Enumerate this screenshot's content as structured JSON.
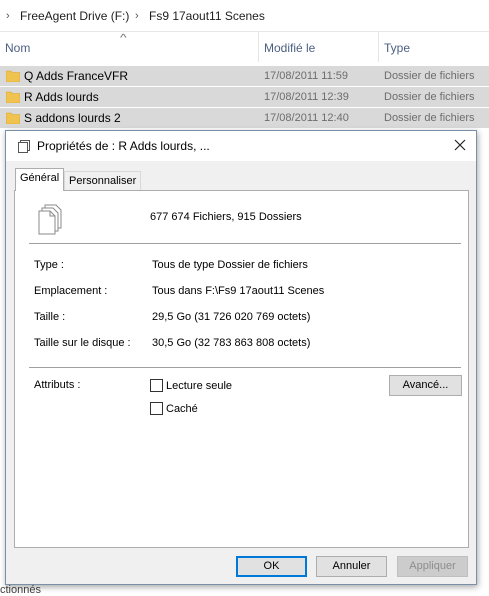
{
  "breadcrumb": {
    "items": [
      "FreeAgent Drive (F:)",
      "Fs9 17aout11 Scenes"
    ]
  },
  "columns": {
    "name": "Nom",
    "modified": "Modifié le",
    "type": "Type"
  },
  "files": [
    {
      "name": "Q Adds FranceVFR",
      "date": "17/08/2011 11:59",
      "type": "Dossier de fichiers"
    },
    {
      "name": "R Adds lourds",
      "date": "17/08/2011 12:39",
      "type": "Dossier de fichiers"
    },
    {
      "name": "S addons lourds 2",
      "date": "17/08/2011 12:40",
      "type": "Dossier de fichiers"
    }
  ],
  "status_fragment": "ctionnés",
  "dialog": {
    "title": "Propriétés de : R Adds lourds, ...",
    "tabs": [
      "Général",
      "Personnaliser"
    ],
    "count": "677 674 Fichiers, 915 Dossiers",
    "properties": [
      {
        "label": "Type :",
        "value": "Tous de type Dossier de fichiers"
      },
      {
        "label": "Emplacement :",
        "value": "Tous dans F:\\Fs9 17aout11 Scenes"
      },
      {
        "label": "Taille :",
        "value": "29,5 Go (31 726 020 769 octets)"
      },
      {
        "label": "Taille sur le disque :",
        "value": "30,5 Go (32 783 863 808 octets)"
      }
    ],
    "attributes_label": "Attributs :",
    "readonly_label": "Lecture seule",
    "hidden_label": "Caché",
    "advanced_label": "Avancé...",
    "ok_label": "OK",
    "cancel_label": "Annuler",
    "apply_label": "Appliquer"
  },
  "colors": {
    "row_selected": "#d9d9d9",
    "folder": "#f0c24f",
    "accent": "#0078d7"
  }
}
